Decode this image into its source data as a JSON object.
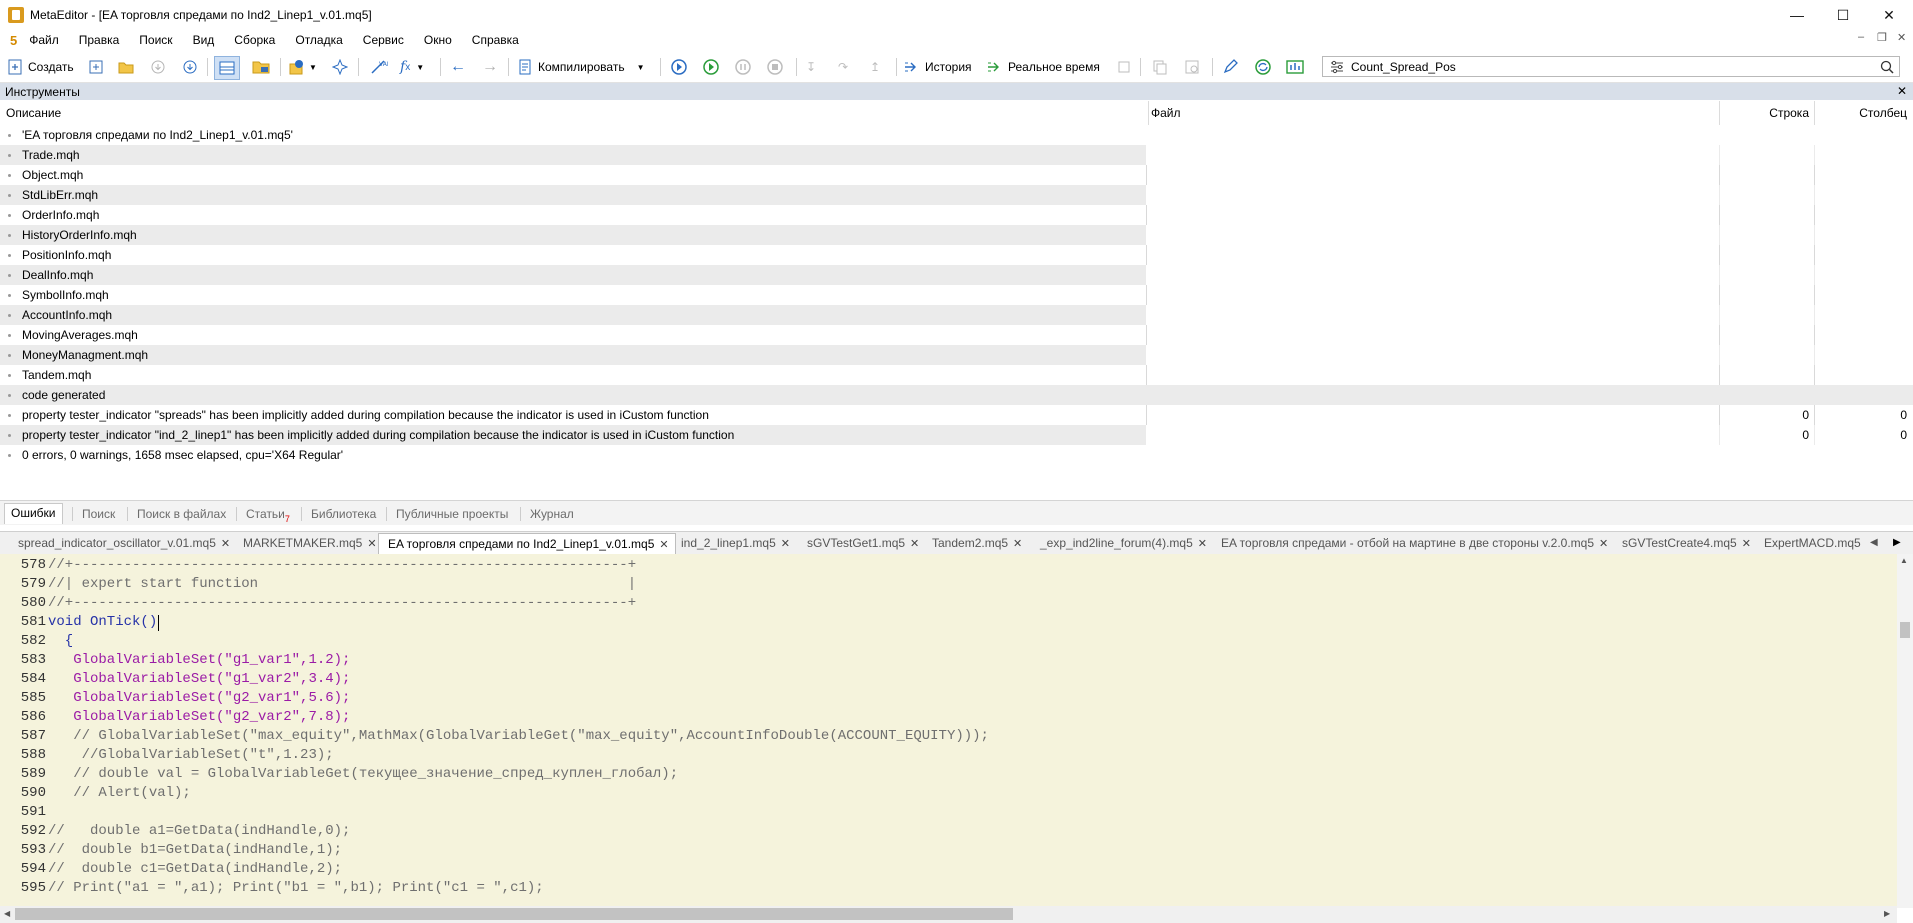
{
  "window": {
    "title": "MetaEditor - [EA торговля спредами по Ind2_Linep1_v.01.mq5]"
  },
  "menu": {
    "logo": "5",
    "items": [
      "Файл",
      "Правка",
      "Поиск",
      "Вид",
      "Сборка",
      "Отладка",
      "Сервис",
      "Окно",
      "Справка"
    ]
  },
  "toolbar": {
    "create": "Создать",
    "compile": "Компилировать",
    "history": "История",
    "realtime": "Реальное время",
    "search_value": "Count_Spread_Pos"
  },
  "toolbox": {
    "header": "Инструменты",
    "columns": {
      "desc": "Описание",
      "file": "Файл",
      "line": "Строка",
      "col": "Столбец"
    },
    "rows": [
      {
        "desc": "'EA торговля спредами по Ind2_Linep1_v.01.mq5'",
        "line": "",
        "col": ""
      },
      {
        "desc": "Trade.mqh",
        "line": "",
        "col": ""
      },
      {
        "desc": "Object.mqh",
        "line": "",
        "col": ""
      },
      {
        "desc": "StdLibErr.mqh",
        "line": "",
        "col": ""
      },
      {
        "desc": "OrderInfo.mqh",
        "line": "",
        "col": ""
      },
      {
        "desc": "HistoryOrderInfo.mqh",
        "line": "",
        "col": ""
      },
      {
        "desc": "PositionInfo.mqh",
        "line": "",
        "col": ""
      },
      {
        "desc": "DealInfo.mqh",
        "line": "",
        "col": ""
      },
      {
        "desc": "SymbolInfo.mqh",
        "line": "",
        "col": ""
      },
      {
        "desc": "AccountInfo.mqh",
        "line": "",
        "col": ""
      },
      {
        "desc": "MovingAverages.mqh",
        "line": "",
        "col": ""
      },
      {
        "desc": "MoneyManagment.mqh",
        "line": "",
        "col": ""
      },
      {
        "desc": "Tandem.mqh",
        "line": "",
        "col": ""
      },
      {
        "desc": "code generated",
        "line": "",
        "col": ""
      },
      {
        "desc": "property tester_indicator \"spreads\" has been implicitly added during compilation because the indicator is used in iCustom function",
        "line": "0",
        "col": "0"
      },
      {
        "desc": "property tester_indicator \"ind_2_linep1\" has been implicitly added during compilation because the indicator is used in iCustom function",
        "line": "0",
        "col": "0"
      },
      {
        "desc": "0 errors, 0 warnings, 1658 msec elapsed, cpu='X64 Regular'",
        "line": "",
        "col": ""
      }
    ]
  },
  "bottom_tabs": {
    "errors": "Ошибки",
    "search": "Поиск",
    "search_files": "Поиск в файлах",
    "articles": "Статьи",
    "articles_badge": "7",
    "library": "Библиотека",
    "public_projects": "Публичные проекты",
    "journal": "Журнал"
  },
  "file_tabs": [
    "spread_indicator_oscillator_v.01.mq5",
    "MARKETMAKER.mq5",
    "EA торговля спредами по Ind2_Linep1_v.01.mq5",
    "ind_2_linep1.mq5",
    "sGVTestGet1.mq5",
    "Tandem2.mq5",
    "_exp_ind2line_forum(4).mq5",
    "EA торговля спредами - отбой на мартине в две стороны v.2.0.mq5",
    "sGVTestCreate4.mq5",
    "ExpertMACD.mq5"
  ],
  "editor": {
    "lines": [
      {
        "n": "578",
        "text": "//+------------------------------------------------------------------+"
      },
      {
        "n": "579",
        "text": "//| expert start function                                            |"
      },
      {
        "n": "580",
        "text": "//+------------------------------------------------------------------+"
      },
      {
        "n": "581",
        "text": "void OnTick()"
      },
      {
        "n": "582",
        "text": "  {"
      },
      {
        "n": "583",
        "text": "   GlobalVariableSet(\"g1_var1\",1.2);"
      },
      {
        "n": "584",
        "text": "   GlobalVariableSet(\"g1_var2\",3.4);"
      },
      {
        "n": "585",
        "text": "   GlobalVariableSet(\"g2_var1\",5.6);"
      },
      {
        "n": "586",
        "text": "   GlobalVariableSet(\"g2_var2\",7.8);"
      },
      {
        "n": "587",
        "text": "   // GlobalVariableSet(\"max_equity\",MathMax(GlobalVariableGet(\"max_equity\",AccountInfoDouble(ACCOUNT_EQUITY)));"
      },
      {
        "n": "588",
        "text": "    //GlobalVariableSet(\"t\",1.23);"
      },
      {
        "n": "589",
        "text": "   // double val = GlobalVariableGet(текущее_значение_спред_куплен_глобал);"
      },
      {
        "n": "590",
        "text": "   // Alert(val);"
      },
      {
        "n": "591",
        "text": ""
      },
      {
        "n": "592",
        "text": "//   double a1=GetData(indHandle,0);"
      },
      {
        "n": "593",
        "text": "//  double b1=GetData(indHandle,1);"
      },
      {
        "n": "594",
        "text": "//  double c1=GetData(indHandle,2);"
      },
      {
        "n": "595",
        "text": "// Print(\"a1 = \",a1); Print(\"b1 = \",b1); Print(\"c1 = \",c1);"
      }
    ]
  }
}
